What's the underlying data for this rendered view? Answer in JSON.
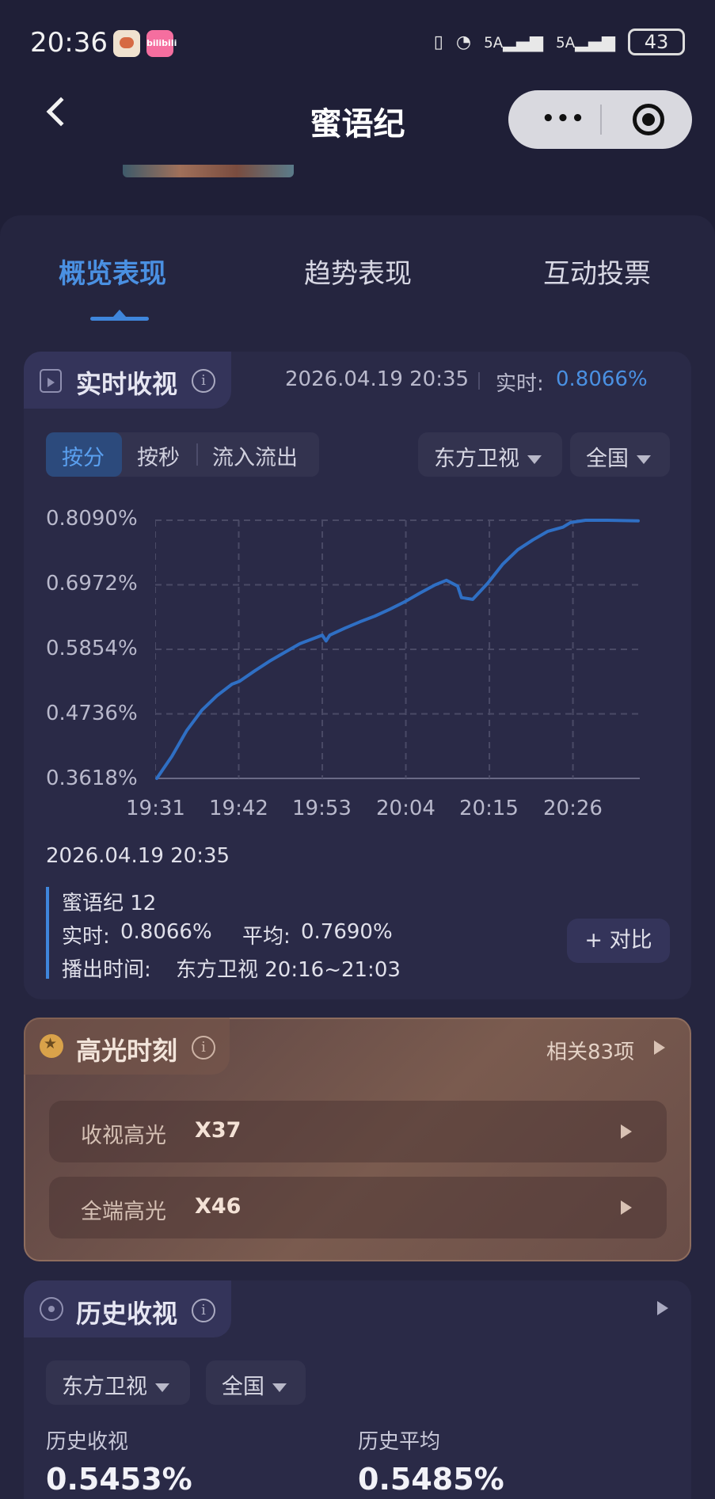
{
  "status_bar": {
    "time": "20:36",
    "app2": "bilibili",
    "battery": "43",
    "signal1": "5A",
    "signal2": "5A"
  },
  "header": {
    "title": "蜜语纪",
    "menu": "•••"
  },
  "tabs": [
    {
      "label": "概览表现",
      "active": true
    },
    {
      "label": "趋势表现",
      "active": false
    },
    {
      "label": "互动投票",
      "active": false
    }
  ],
  "realtime": {
    "title": "实时收视",
    "timestamp": "2026.04.19 20:35",
    "realtime_label": "实时:",
    "realtime_value": "0.8066%",
    "segments": [
      "按分",
      "按秒",
      "流入流出"
    ],
    "channel": "东方卫视",
    "region": "全国",
    "detail": {
      "timestamp": "2026.04.19 20:35",
      "episode": "蜜语纪 12",
      "realtime_label": "实时:",
      "realtime_value": "0.8066%",
      "avg_label": "平均:",
      "avg_value": "0.7690%",
      "airtime_label": "播出时间:",
      "airtime_value": "东方卫视 20:16~21:03"
    },
    "compare_button": "+ 对比"
  },
  "chart_data": {
    "type": "line",
    "y_ticks": [
      "0.8090%",
      "0.6972%",
      "0.5854%",
      "0.4736%",
      "0.3618%"
    ],
    "x_ticks": [
      "19:31",
      "19:42",
      "19:53",
      "20:04",
      "20:15",
      "20:26"
    ],
    "ylim": [
      0.3618,
      0.809
    ],
    "grid": true,
    "color": "#2f6fc4",
    "series": [
      {
        "x": [
          0,
          2,
          4,
          6,
          8,
          10,
          11,
          13,
          15,
          17,
          19,
          21,
          22,
          22.5,
          23,
          25,
          27,
          29,
          31,
          33,
          35,
          37,
          38.5,
          40,
          40.5,
          42,
          44,
          46,
          48,
          50,
          52,
          54,
          55,
          57,
          60,
          64
        ],
        "y": [
          0.3618,
          0.4,
          0.445,
          0.48,
          0.505,
          0.525,
          0.53,
          0.548,
          0.565,
          0.58,
          0.595,
          0.605,
          0.61,
          0.6,
          0.61,
          0.622,
          0.633,
          0.643,
          0.655,
          0.668,
          0.683,
          0.697,
          0.705,
          0.695,
          0.675,
          0.672,
          0.7,
          0.733,
          0.758,
          0.775,
          0.79,
          0.797,
          0.805,
          0.809,
          0.809,
          0.808
        ]
      }
    ]
  },
  "highlight": {
    "title": "高光时刻",
    "related": "相关83项",
    "rows": [
      {
        "label": "收视高光",
        "value": "X37"
      },
      {
        "label": "全端高光",
        "value": "X46"
      }
    ]
  },
  "history": {
    "title": "历史收视",
    "channel": "东方卫视",
    "region": "全国",
    "hist_label": "历史收视",
    "hist_value": "0.5453%",
    "avg_label": "历史平均",
    "avg_value": "0.5485%"
  }
}
